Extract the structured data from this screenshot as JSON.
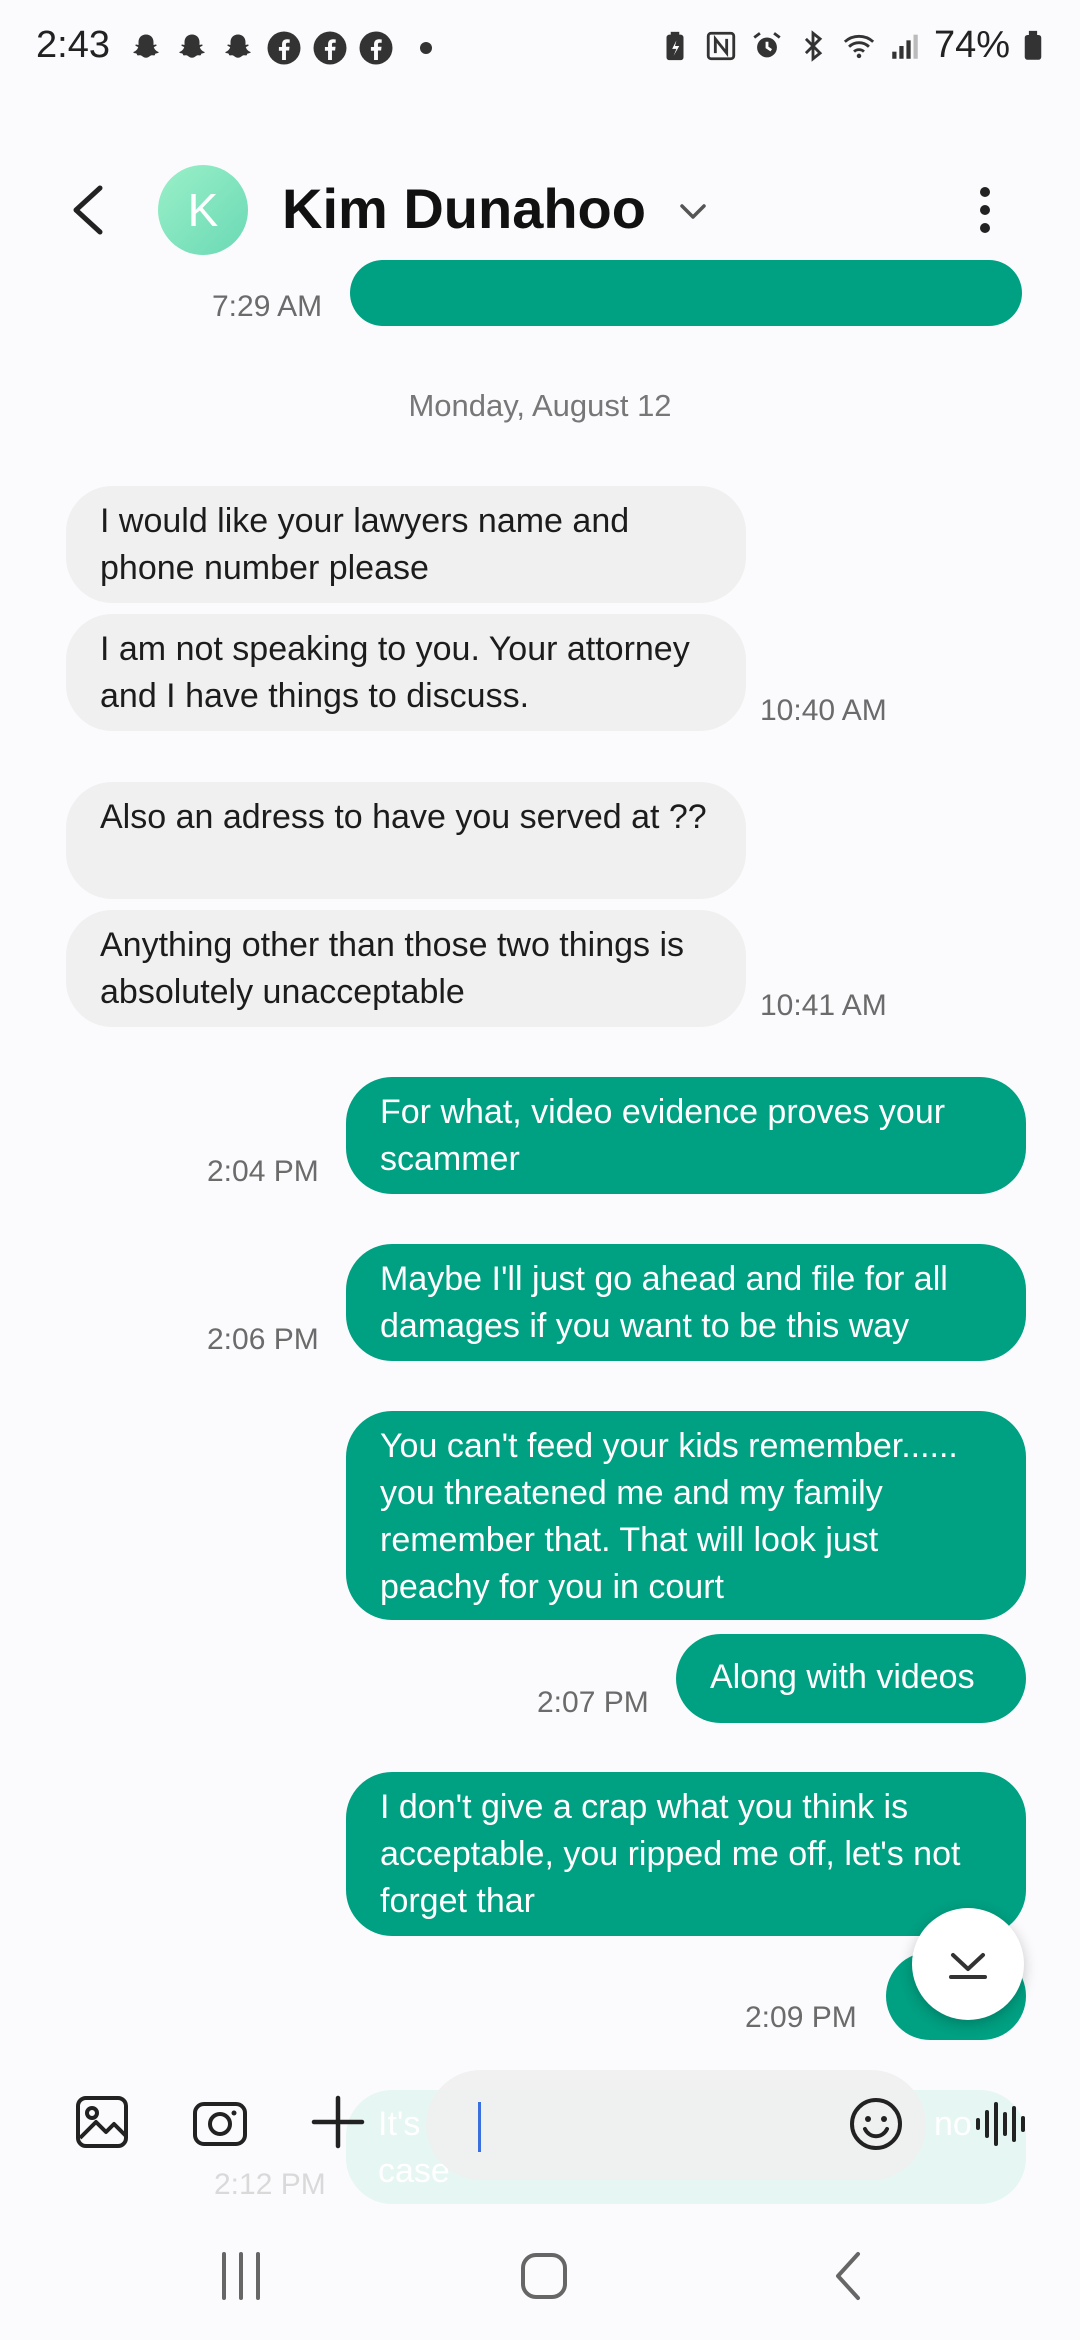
{
  "status_bar": {
    "time": "2:43",
    "battery": "74%"
  },
  "header": {
    "contact_initial": "K",
    "contact_name": "Kim Dunahoo"
  },
  "thread": {
    "partial_timestamp": "7:29 AM",
    "date_divider": "Monday, August 12",
    "messages": [
      {
        "dir": "in",
        "text": "I would like your lawyers name and phone number please"
      },
      {
        "dir": "in",
        "text": "I am not speaking to you.  Your attorney and I have things to discuss.",
        "time": "10:40 AM"
      },
      {
        "dir": "in",
        "text": "Also an adress to have you served at ??"
      },
      {
        "dir": "in",
        "text": "Anything other than those two things is absolutely unacceptable",
        "time": "10:41 AM"
      },
      {
        "dir": "out",
        "text": "For what,  video evidence proves your scammer",
        "time": "2:04 PM"
      },
      {
        "dir": "out",
        "text": "Maybe I'll just go ahead and file for all damages if you want to be this way",
        "time": "2:06 PM"
      },
      {
        "dir": "out",
        "text": "You can't feed your kids remember...... you threatened me and my family remember that.  That will look just peachy for you in court"
      },
      {
        "dir": "out",
        "text": "Along with videos",
        "time": "2:07 PM"
      },
      {
        "dir": "out",
        "text": "I don't give a crap what you think is acceptable, you ripped me off, let's not forget thar"
      },
      {
        "dir": "out",
        "text": "",
        "time": "2:09 PM"
      },
      {
        "dir": "out",
        "text": "It's",
        "text_tail": "no",
        "text_line2": "case",
        "time": "2:12 PM"
      }
    ]
  },
  "colors": {
    "outgoing": "#00a082",
    "incoming": "#f0f0f0",
    "avatar": "#7fe3c0"
  },
  "icons": [
    "gallery-icon",
    "camera-icon",
    "plus-icon",
    "emoji-icon",
    "voice-icon",
    "scroll-down-icon"
  ]
}
